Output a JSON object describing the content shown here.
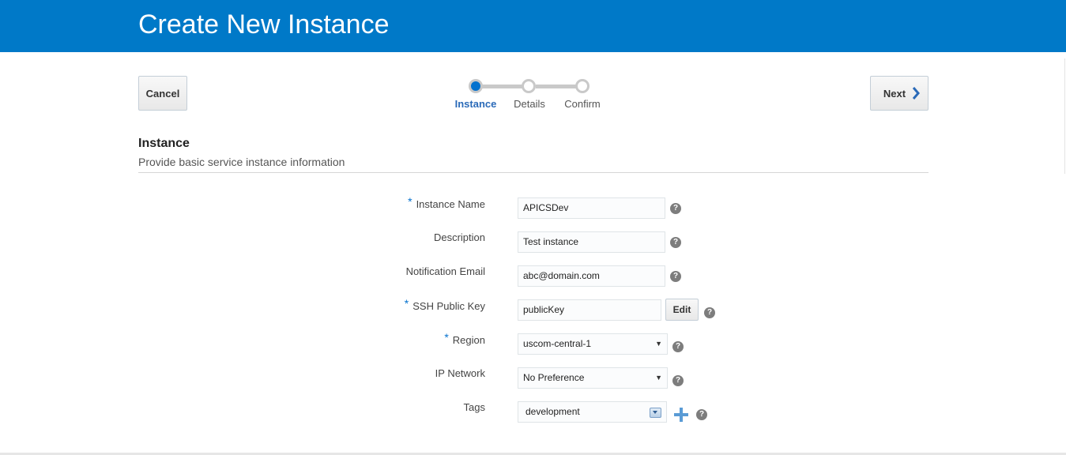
{
  "header": {
    "title": "Create New Instance"
  },
  "toolbar": {
    "cancel_label": "Cancel",
    "next_label": "Next"
  },
  "train": {
    "steps": [
      {
        "label": "Instance",
        "active": true
      },
      {
        "label": "Details",
        "active": false
      },
      {
        "label": "Confirm",
        "active": false
      }
    ]
  },
  "section": {
    "title": "Instance",
    "subtitle": "Provide basic service instance information"
  },
  "form": {
    "instance_name": {
      "label": "Instance Name",
      "required": "*",
      "value": "APICSDev"
    },
    "description": {
      "label": "Description",
      "value": "Test instance"
    },
    "notification_email": {
      "label": "Notification Email",
      "value": "abc@domain.com"
    },
    "ssh_public_key": {
      "label": "SSH Public Key",
      "required": "*",
      "value": "publicKey",
      "edit_label": "Edit"
    },
    "region": {
      "label": "Region",
      "required": "*",
      "value": "uscom-central-1"
    },
    "ip_network": {
      "label": "IP Network",
      "value": "No Preference"
    },
    "tags": {
      "label": "Tags",
      "value": "development"
    },
    "help_glyph": "?",
    "select_caret": "▼"
  },
  "colors": {
    "header_bg": "#0079c8",
    "accent": "#0572ce",
    "active_step": "#2a6ab8"
  },
  "icons": [
    "chevron-right-icon",
    "help-icon",
    "plus-icon",
    "dropdown-icon"
  ]
}
